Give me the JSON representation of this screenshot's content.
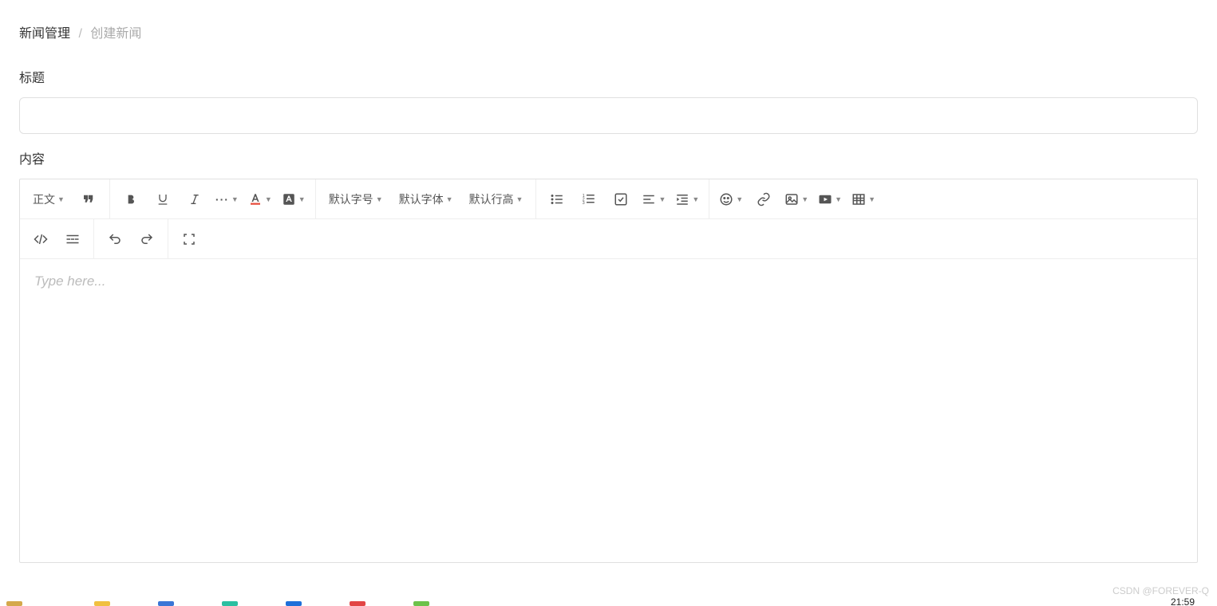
{
  "breadcrumb": {
    "root": "新闻管理",
    "separator": "/",
    "current": "创建新闻"
  },
  "form": {
    "title_label": "标题",
    "title_value": "",
    "content_label": "内容"
  },
  "toolbar": {
    "heading_label": "正文",
    "font_size_label": "默认字号",
    "font_family_label": "默认字体",
    "line_height_label": "默认行高",
    "more_glyph": "···",
    "icons": {
      "quote": "quote-icon",
      "bold": "bold-icon",
      "underline": "underline-icon",
      "italic": "italic-icon",
      "font_color": "font-color-icon",
      "bg_color": "bg-color-icon",
      "ul": "unordered-list-icon",
      "ol": "ordered-list-icon",
      "todo": "todo-icon",
      "align": "align-icon",
      "indent": "indent-icon",
      "emoji": "emoji-icon",
      "link": "link-icon",
      "image": "image-icon",
      "video": "video-icon",
      "table": "table-icon",
      "code": "code-icon",
      "divider": "divider-icon",
      "undo": "undo-icon",
      "redo": "redo-icon",
      "fullscreen": "fullscreen-icon"
    }
  },
  "editor": {
    "placeholder": "Type here..."
  },
  "watermark": "CSDN @FOREVER-Q",
  "system_time": "21:59"
}
